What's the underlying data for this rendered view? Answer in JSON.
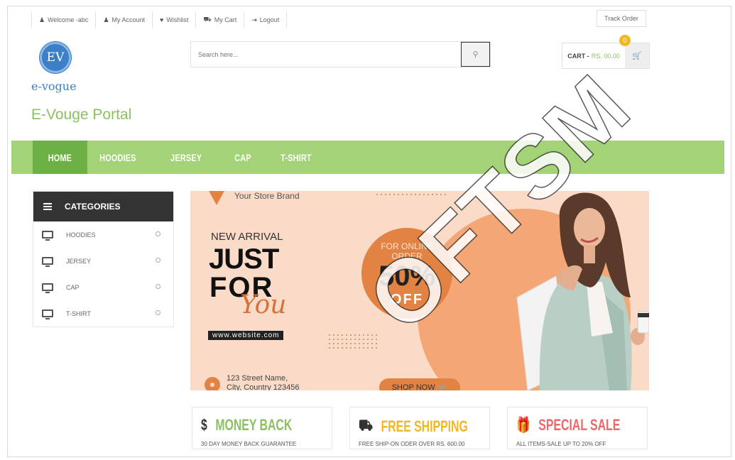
{
  "topbar": {
    "links": [
      {
        "icon": "user-icon",
        "glyph": "♟",
        "label": "Welcome -abc"
      },
      {
        "icon": "user-icon",
        "glyph": "♟",
        "label": "My Account"
      },
      {
        "icon": "heart-icon",
        "glyph": "♥",
        "label": "Wishlist"
      },
      {
        "icon": "cart-icon",
        "glyph": "⛟",
        "label": "My Cart"
      },
      {
        "icon": "logout-icon",
        "glyph": "⇥",
        "label": "Logout"
      }
    ],
    "track_order": "Track Order"
  },
  "logo": {
    "monogram": "EV",
    "text": "e-vogue",
    "brand_color": "#3c7fc7"
  },
  "site_name": "E-Vouge Portal",
  "search": {
    "placeholder": "Search here...",
    "icon": "search-icon"
  },
  "cart": {
    "label": "CART -",
    "amount": "RS. 00.00",
    "count": "0",
    "icon": "cart-icon"
  },
  "nav": {
    "items": [
      "HOME",
      "HOODIES",
      "JERSEY",
      "CAP",
      "T-SHIRT"
    ],
    "active": "HOME",
    "bar_color": "#a3d277",
    "active_color": "#6db044"
  },
  "categories": {
    "title": "CATEGORIES",
    "items": [
      "HOODIES",
      "JERSEY",
      "CAP",
      "T-SHIRT"
    ]
  },
  "banner": {
    "brand": "Your Store Brand",
    "new_arrival": "NEW ARRIVAL",
    "just": "JUST",
    "for": "FOR",
    "you": "You",
    "website": "www.website.com",
    "online_line1": "FOR ONLINE",
    "online_line2": "ORDER",
    "discount": "50%",
    "off": "OFF",
    "address_line1": "123 Street Name,",
    "address_line2": "City, Country 123456",
    "shop_now": "SHOP NOW"
  },
  "features": [
    {
      "icon": "dollar-icon",
      "glyph": "$",
      "title": "MONEY BACK",
      "subtitle": "30 DAY MONEY BACK GUARANTEE",
      "color": "#8cc063"
    },
    {
      "icon": "truck-icon",
      "glyph": "⛟",
      "title": "FREE SHIPPING",
      "subtitle": "FREE SHIP-ON ODER OVER RS. 600.00",
      "color": "#f2b824"
    },
    {
      "icon": "gift-icon",
      "glyph": "🎁",
      "title": "SPECIAL SALE",
      "subtitle": "ALL ITEMS-SALE UP TO 20% OFF",
      "color": "#e86a6a"
    }
  ],
  "watermark": "OFTSM"
}
